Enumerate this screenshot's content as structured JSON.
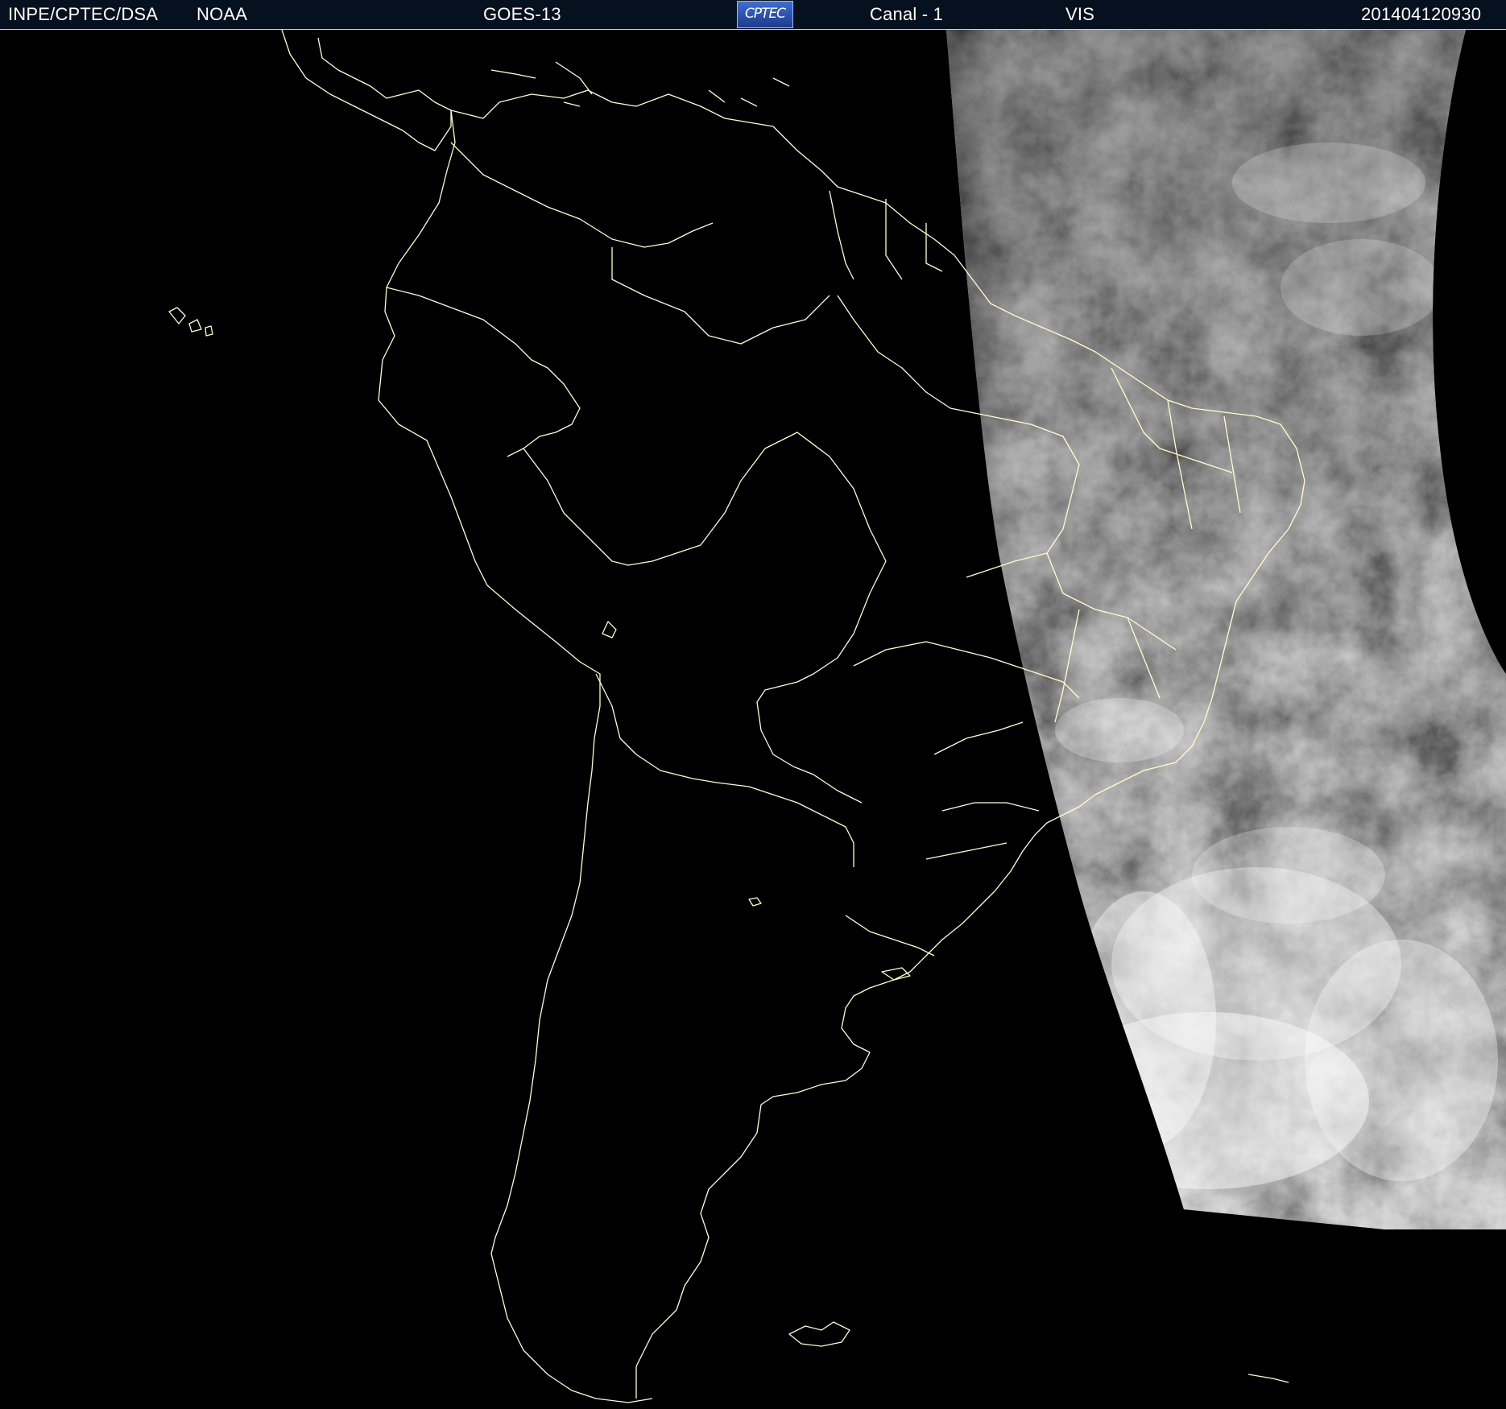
{
  "header": {
    "institution": "INPE/CPTEC/DSA",
    "agency": "NOAA",
    "satellite": "GOES-13",
    "logo_text": "CPTEC",
    "channel": "Canal - 1",
    "band": "VIS",
    "timestamp": "201404120930"
  },
  "colors": {
    "background": "#000000",
    "coastline": "#ffffcc",
    "header_bg": "#06111f",
    "header_text": "#ffffff"
  }
}
